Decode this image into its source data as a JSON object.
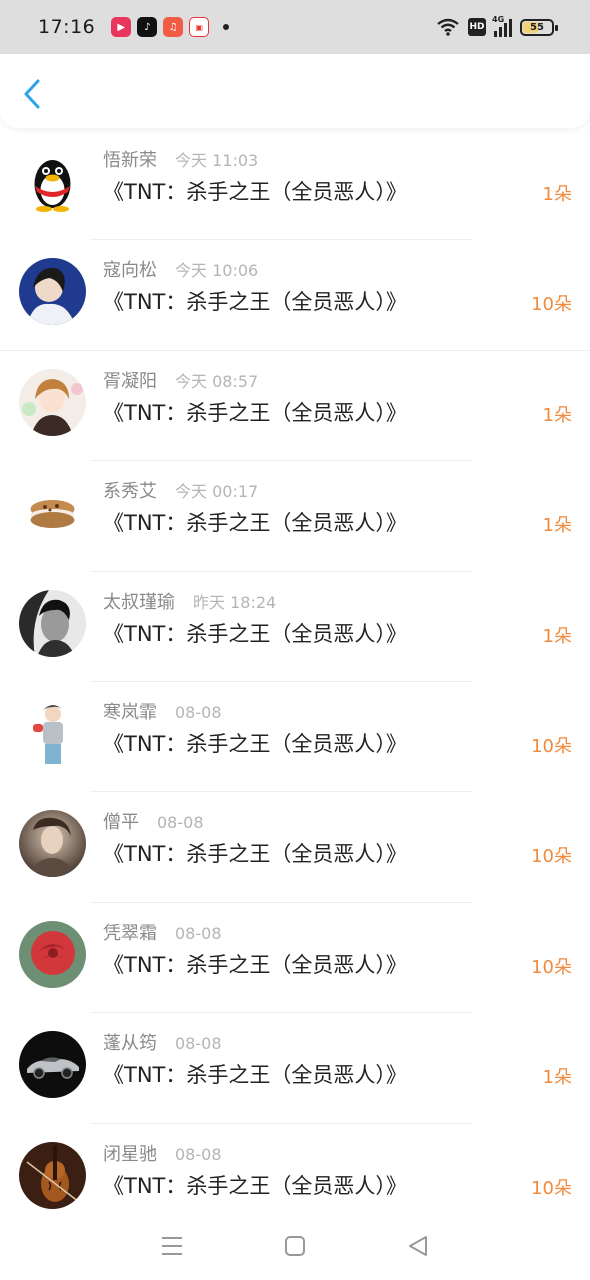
{
  "status_bar": {
    "time": "17:16",
    "network": "4G",
    "hd": "HD",
    "battery_percent": 55
  },
  "items": [
    {
      "name": "悟新荣",
      "time": "今天 11:03",
      "title": "《TNT：杀手之王（全员恶人）》",
      "count": "1朵",
      "avatar": "qq-penguin-avatar"
    },
    {
      "name": "寇向松",
      "time": "今天 10:06",
      "title": "《TNT：杀手之王（全员恶人）》",
      "count": "10朵",
      "avatar": "portrait-avatar"
    },
    {
      "name": "胥凝阳",
      "time": "今天 08:57",
      "title": "《TNT：杀手之王（全员恶人）》",
      "count": "1朵",
      "avatar": "anime-avatar"
    },
    {
      "name": "系秀艾",
      "time": "今天 00:17",
      "title": "《TNT：杀手之王（全员恶人）》",
      "count": "1朵",
      "avatar": "cookie-avatar"
    },
    {
      "name": "太叔瑾瑜",
      "time": "昨天 18:24",
      "title": "《TNT：杀手之王（全员恶人）》",
      "count": "1朵",
      "avatar": "bw-portrait-avatar"
    },
    {
      "name": "寒岚霏",
      "time": "08-08",
      "title": "《TNT：杀手之王（全员恶人）》",
      "count": "10朵",
      "avatar": "illustration-avatar"
    },
    {
      "name": "僧平",
      "time": "08-08",
      "title": "《TNT：杀手之王（全员恶人）》",
      "count": "10朵",
      "avatar": "blurred-photo-avatar"
    },
    {
      "name": "凭翠霜",
      "time": "08-08",
      "title": "《TNT：杀手之王（全员恶人）》",
      "count": "10朵",
      "avatar": "rose-avatar"
    },
    {
      "name": "蓬从筠",
      "time": "08-08",
      "title": "《TNT：杀手之王（全员恶人）》",
      "count": "1朵",
      "avatar": "car-avatar"
    },
    {
      "name": "闭星驰",
      "time": "08-08",
      "title": "《TNT：杀手之王（全员恶人）》",
      "count": "10朵",
      "avatar": "violin-avatar"
    }
  ],
  "colors": {
    "accent": "#2aa3ef",
    "count": "#f08a3c"
  }
}
